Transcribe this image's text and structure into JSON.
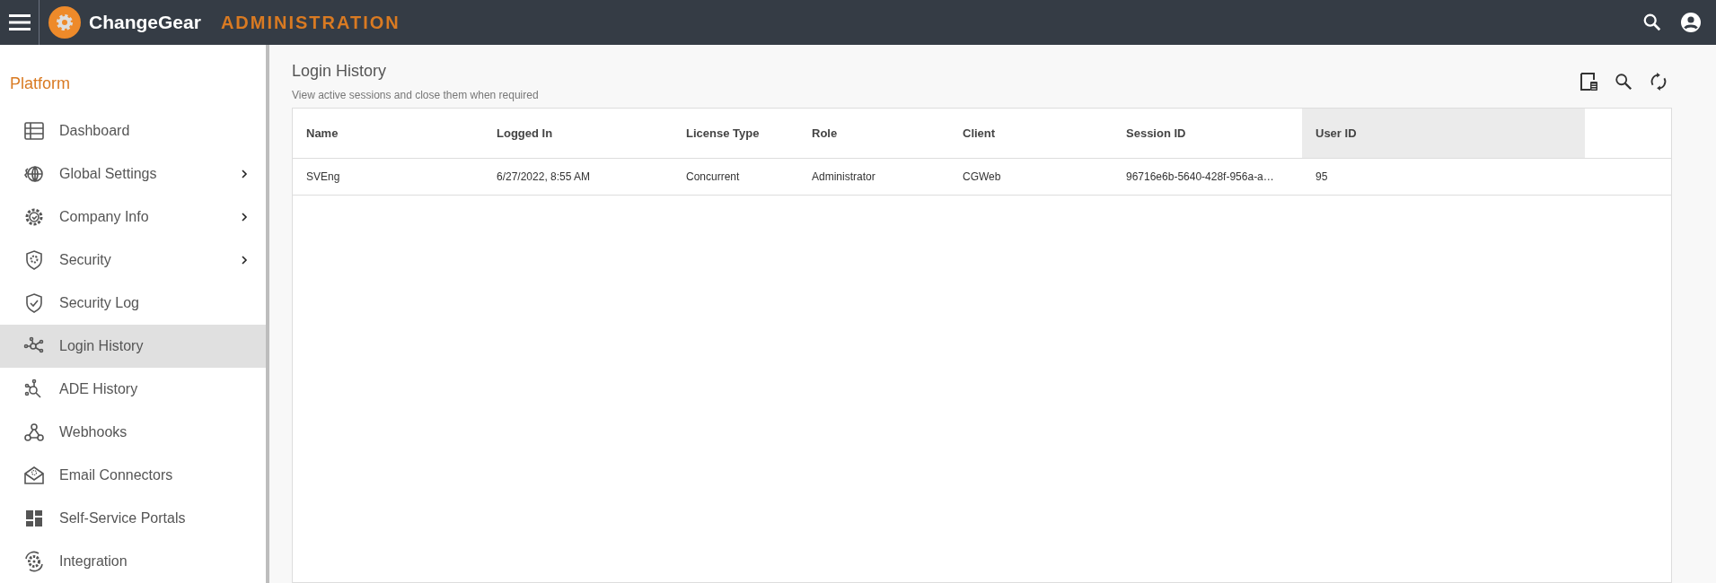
{
  "header": {
    "brand": "ChangeGear",
    "section": "ADMINISTRATION"
  },
  "sidebar": {
    "title": "Platform",
    "items": [
      {
        "label": "Dashboard",
        "expandable": false,
        "selected": false
      },
      {
        "label": "Global Settings",
        "expandable": true,
        "selected": false
      },
      {
        "label": "Company Info",
        "expandable": true,
        "selected": false
      },
      {
        "label": "Security",
        "expandable": true,
        "selected": false
      },
      {
        "label": "Security Log",
        "expandable": false,
        "selected": false
      },
      {
        "label": "Login History",
        "expandable": false,
        "selected": true
      },
      {
        "label": "ADE History",
        "expandable": false,
        "selected": false
      },
      {
        "label": "Webhooks",
        "expandable": false,
        "selected": false
      },
      {
        "label": "Email Connectors",
        "expandable": false,
        "selected": false
      },
      {
        "label": "Self-Service Portals",
        "expandable": false,
        "selected": false
      },
      {
        "label": "Integration",
        "expandable": false,
        "selected": false
      }
    ]
  },
  "page": {
    "title": "Login History",
    "subtitle": "View active sessions and close them when required"
  },
  "table": {
    "columns": [
      {
        "label": "Name",
        "highlighted": false
      },
      {
        "label": "Logged In",
        "highlighted": false
      },
      {
        "label": "License Type",
        "highlighted": false
      },
      {
        "label": "Role",
        "highlighted": false
      },
      {
        "label": "Client",
        "highlighted": false
      },
      {
        "label": "Session ID",
        "highlighted": false
      },
      {
        "label": "User ID",
        "highlighted": true
      }
    ],
    "rows": [
      [
        "SVEng",
        "6/27/2022, 8:55 AM",
        "Concurrent",
        "Administrator",
        "CGWeb",
        "96716e6b-5640-428f-956a-a…",
        "95"
      ]
    ]
  }
}
